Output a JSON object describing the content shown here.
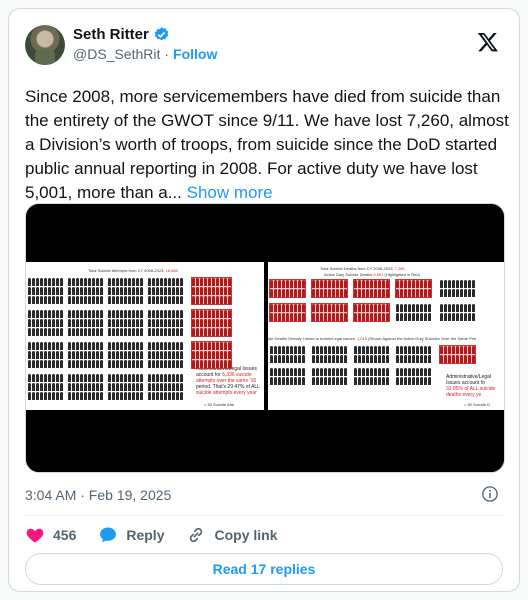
{
  "author": {
    "name": "Seth Ritter",
    "handle": "@DS_SethRit",
    "separator": "·",
    "follow_label": "Follow"
  },
  "tweet": {
    "text": "Since 2008, more servicemembers have died from suicide than the entirety of the GWOT since 9/11. We have lost 7,260, almost a Division’s worth of troops, from suicide since the DoD started public annual reporting in 2008. For active duty we have lost 5,001, more than a...",
    "show_more_label": "Show more",
    "timestamp": "3:04 AM · Feb 19, 2025"
  },
  "media": {
    "left": {
      "title_prefix": "Total Suicide Attempts from CY 2008-2023: ",
      "title_value": "16,666",
      "callout_line1": "Administrative/Legal Issues",
      "callout_line2_prefix": "account for ",
      "callout_line2_value": "5,336 suicide",
      "callout_line3": "attempts over the same '16",
      "callout_line4": "period. That's 29.47% of ALL",
      "callout_line5": "suicide attempts every year",
      "legend": "= 50 Suicide Atte"
    },
    "right": {
      "title_line1_prefix": "Total Suicide Deaths from CY 2008-2023: ",
      "title_line1_value": "7,260",
      "title_line2_prefix": "Active Duty Suicide Deaths ",
      "title_line2_value": "5,001",
      "title_line2_suffix": " (Highlighted in Red)",
      "subtitle_left": "ide Deaths Directly Linked to Admin/Legal Issues: ",
      "subtitle_value": "1,015",
      "subtitle_right": " (Shown Against the Active Duty Suicides Over the Same Peri",
      "callout_line1": "Administrative/Legal Issues account fo",
      "callout_line2": "32.85% of ALL suicide deaths every ye",
      "legend": "= 50 Suicide D"
    }
  },
  "actions": {
    "likes": "456",
    "reply_label": "Reply",
    "copy_link_label": "Copy link"
  },
  "read_replies_label": "Read 17 replies",
  "colors": {
    "accent": "#1d9bf0",
    "like": "#f91880",
    "muted": "#536471"
  }
}
